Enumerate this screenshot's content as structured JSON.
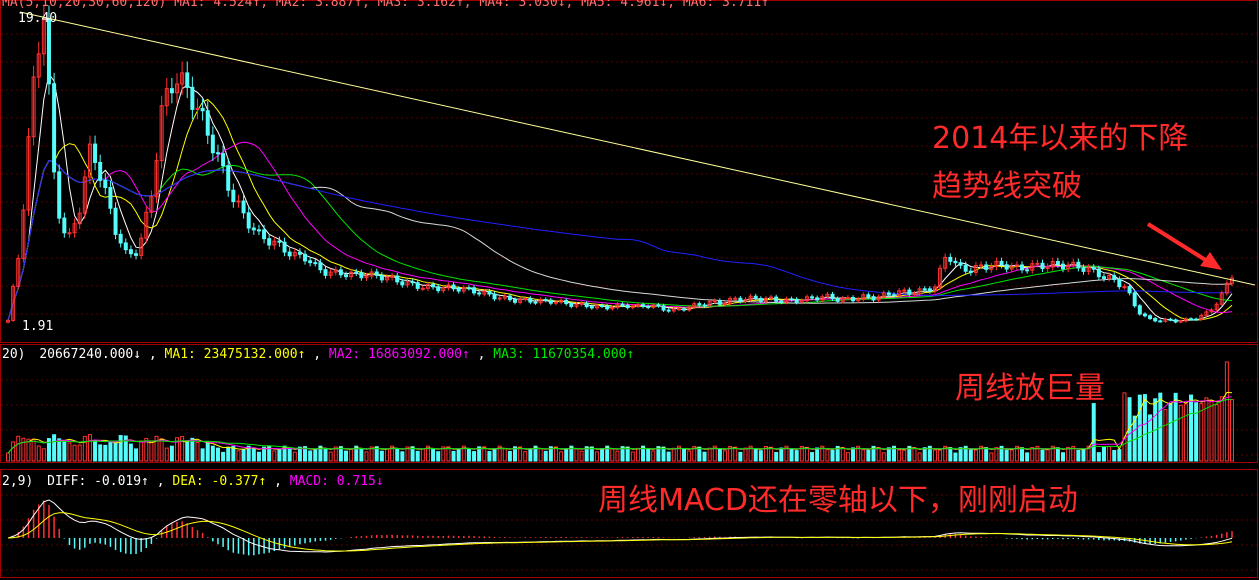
{
  "colors": {
    "background": "#000000",
    "panel_border": "#a00000",
    "grid": "#5a0000",
    "up": "#ff3232",
    "down": "#54fcfc",
    "ma1": "#ffffff",
    "ma2": "#ffff00",
    "ma3": "#ff00ff",
    "ma4": "#00e600",
    "ma5": "#d8d8d8",
    "ma6": "#2020ff",
    "trendline": "#ffff99",
    "annotation": "#ff2a2a"
  },
  "price_panel": {
    "header": "MA(5,10,20,30,60,120)  MA1: 4.524↑, MA2: 3.887↑, MA3: 3.162↑, MA4: 3.030↓, MA5: 4.961↓, MA6: 3.711↑",
    "high_label": "19.40",
    "low_label": "1.91",
    "annotation_line1": "2014年以来的下降",
    "annotation_line2": "趋势线突破"
  },
  "volume_panel": {
    "header_prefix": "20)",
    "vol": "20667240.000↓",
    "ma1": "MA1: 23475132.000↑",
    "ma2": "MA2: 16863092.000↑",
    "ma3": "MA3: 11670354.000↑",
    "annotation": "周线放巨量"
  },
  "macd_panel": {
    "header_prefix": "2,9)",
    "diff": "DIFF: -0.019↑",
    "dea": "DEA: -0.377↑",
    "macd": "MACD: 0.715↓",
    "annotation": "周线MACD还在零轴以下，刚刚启动"
  },
  "chart_data": {
    "type": "candlestick",
    "price_range": [
      1.91,
      19.4
    ],
    "price_closes": [
      2.0,
      6.0,
      14.0,
      19.4,
      9.0,
      6.5,
      8.5,
      12.0,
      9.5,
      7.0,
      5.5,
      6.0,
      9.0,
      14.5,
      16.0,
      15.0,
      13.5,
      12.0,
      10.5,
      9.0,
      8.0,
      7.0,
      6.5,
      6.0,
      5.5,
      5.5,
      5.0,
      4.8,
      4.8,
      4.6,
      4.5,
      4.4,
      4.3,
      4.2,
      4.1,
      4.0,
      3.9,
      3.8,
      3.7,
      3.6,
      3.5,
      3.4,
      3.3,
      3.2,
      3.1,
      3.0,
      3.0,
      2.9,
      2.9,
      2.9,
      2.8,
      2.8,
      2.8,
      2.7,
      2.8,
      2.7,
      2.6,
      2.8,
      2.9,
      3.0,
      2.9,
      3.1,
      3.2,
      3.3,
      3.3,
      3.2,
      3.1,
      3.1,
      3.2,
      3.3,
      3.2,
      3.3,
      3.4,
      3.3,
      3.4,
      3.5,
      3.5,
      3.7,
      4.0,
      6.0,
      5.0,
      4.8,
      4.9,
      5.0,
      5.1,
      5.0,
      5.2,
      5.2,
      5.1,
      5.0,
      4.9,
      4.8,
      4.6,
      4.4,
      4.0,
      2.6,
      2.0,
      1.95,
      1.95,
      2.0,
      2.2,
      2.5,
      3.3,
      4.5
    ],
    "volume_series_note": "weekly volume bars, MA1/MA2/MA3 of volume",
    "macd_series_note": "DIFF, DEA lines with MACD histogram"
  }
}
